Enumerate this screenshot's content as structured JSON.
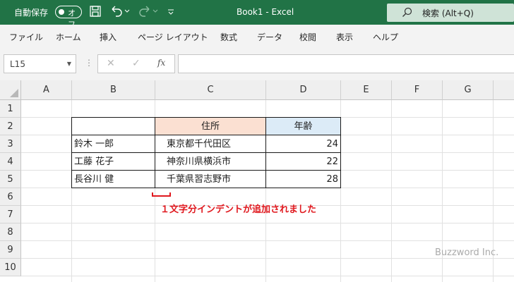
{
  "titlebar": {
    "autosave_label": "自動保存",
    "autosave_state": "オフ",
    "document_title": "Book1  -  Excel",
    "search_label": "検索 (Alt+Q)",
    "bg_color": "#217346"
  },
  "ribbon": {
    "tabs": [
      "ファイル",
      "ホーム",
      "挿入",
      "ページ レイアウト",
      "数式",
      "データ",
      "校閲",
      "表示",
      "ヘルプ"
    ]
  },
  "formula_bar": {
    "name_box": "L15",
    "fx_label": "fx",
    "formula": ""
  },
  "sheet": {
    "columns": [
      "A",
      "B",
      "C",
      "D",
      "E",
      "F",
      "G"
    ],
    "rows": [
      "1",
      "2",
      "3",
      "4",
      "5",
      "6",
      "7",
      "8",
      "9",
      "10"
    ],
    "table": {
      "header_address": "住所",
      "header_age": "年齢",
      "rows": [
        {
          "name": "鈴木 一郎",
          "address": "東京都千代田区",
          "age": "24"
        },
        {
          "name": "工藤 花子",
          "address": "神奈川県横浜市",
          "age": "22"
        },
        {
          "name": "長谷川 健",
          "address": "千葉県習志野市",
          "age": "28"
        }
      ],
      "header_address_color": "#fbe0d2",
      "header_age_color": "#dcebf7"
    }
  },
  "annotation": {
    "text": "１文字分インデントが追加されました",
    "color": "#e0181e"
  },
  "watermark": "Buzzword Inc."
}
